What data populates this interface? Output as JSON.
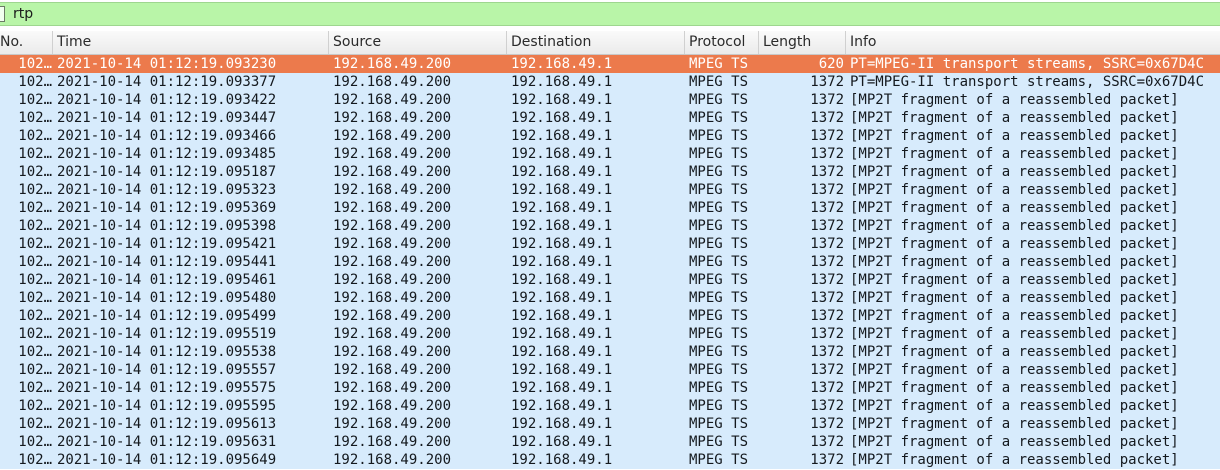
{
  "filter": {
    "value": "rtp"
  },
  "columns": {
    "no": "No.",
    "time": "Time",
    "source": "Source",
    "destination": "Destination",
    "protocol": "Protocol",
    "length": "Length",
    "info": "Info"
  },
  "colors": {
    "filter_bg": "#b9f5a8",
    "row_bg": "#d7ebfc",
    "selected_bg": "#ec7a4c"
  },
  "rows": [
    {
      "no": "102…",
      "time": "2021-10-14 01:12:19.093230",
      "source": "192.168.49.200",
      "destination": "192.168.49.1",
      "protocol": "MPEG TS",
      "length": "620",
      "info": "PT=MPEG-II transport streams, SSRC=0x67D4C",
      "selected": true
    },
    {
      "no": "102…",
      "time": "2021-10-14 01:12:19.093377",
      "source": "192.168.49.200",
      "destination": "192.168.49.1",
      "protocol": "MPEG TS",
      "length": "1372",
      "info": "PT=MPEG-II transport streams, SSRC=0x67D4C"
    },
    {
      "no": "102…",
      "time": "2021-10-14 01:12:19.093422",
      "source": "192.168.49.200",
      "destination": "192.168.49.1",
      "protocol": "MPEG TS",
      "length": "1372",
      "info": "[MP2T fragment of a reassembled packet]"
    },
    {
      "no": "102…",
      "time": "2021-10-14 01:12:19.093447",
      "source": "192.168.49.200",
      "destination": "192.168.49.1",
      "protocol": "MPEG TS",
      "length": "1372",
      "info": "[MP2T fragment of a reassembled packet]"
    },
    {
      "no": "102…",
      "time": "2021-10-14 01:12:19.093466",
      "source": "192.168.49.200",
      "destination": "192.168.49.1",
      "protocol": "MPEG TS",
      "length": "1372",
      "info": "[MP2T fragment of a reassembled packet]"
    },
    {
      "no": "102…",
      "time": "2021-10-14 01:12:19.093485",
      "source": "192.168.49.200",
      "destination": "192.168.49.1",
      "protocol": "MPEG TS",
      "length": "1372",
      "info": "[MP2T fragment of a reassembled packet]"
    },
    {
      "no": "102…",
      "time": "2021-10-14 01:12:19.095187",
      "source": "192.168.49.200",
      "destination": "192.168.49.1",
      "protocol": "MPEG TS",
      "length": "1372",
      "info": "[MP2T fragment of a reassembled packet]"
    },
    {
      "no": "102…",
      "time": "2021-10-14 01:12:19.095323",
      "source": "192.168.49.200",
      "destination": "192.168.49.1",
      "protocol": "MPEG TS",
      "length": "1372",
      "info": "[MP2T fragment of a reassembled packet]"
    },
    {
      "no": "102…",
      "time": "2021-10-14 01:12:19.095369",
      "source": "192.168.49.200",
      "destination": "192.168.49.1",
      "protocol": "MPEG TS",
      "length": "1372",
      "info": "[MP2T fragment of a reassembled packet]"
    },
    {
      "no": "102…",
      "time": "2021-10-14 01:12:19.095398",
      "source": "192.168.49.200",
      "destination": "192.168.49.1",
      "protocol": "MPEG TS",
      "length": "1372",
      "info": "[MP2T fragment of a reassembled packet]"
    },
    {
      "no": "102…",
      "time": "2021-10-14 01:12:19.095421",
      "source": "192.168.49.200",
      "destination": "192.168.49.1",
      "protocol": "MPEG TS",
      "length": "1372",
      "info": "[MP2T fragment of a reassembled packet]"
    },
    {
      "no": "102…",
      "time": "2021-10-14 01:12:19.095441",
      "source": "192.168.49.200",
      "destination": "192.168.49.1",
      "protocol": "MPEG TS",
      "length": "1372",
      "info": "[MP2T fragment of a reassembled packet]"
    },
    {
      "no": "102…",
      "time": "2021-10-14 01:12:19.095461",
      "source": "192.168.49.200",
      "destination": "192.168.49.1",
      "protocol": "MPEG TS",
      "length": "1372",
      "info": "[MP2T fragment of a reassembled packet]"
    },
    {
      "no": "102…",
      "time": "2021-10-14 01:12:19.095480",
      "source": "192.168.49.200",
      "destination": "192.168.49.1",
      "protocol": "MPEG TS",
      "length": "1372",
      "info": "[MP2T fragment of a reassembled packet]"
    },
    {
      "no": "102…",
      "time": "2021-10-14 01:12:19.095499",
      "source": "192.168.49.200",
      "destination": "192.168.49.1",
      "protocol": "MPEG TS",
      "length": "1372",
      "info": "[MP2T fragment of a reassembled packet]"
    },
    {
      "no": "102…",
      "time": "2021-10-14 01:12:19.095519",
      "source": "192.168.49.200",
      "destination": "192.168.49.1",
      "protocol": "MPEG TS",
      "length": "1372",
      "info": "[MP2T fragment of a reassembled packet]"
    },
    {
      "no": "102…",
      "time": "2021-10-14 01:12:19.095538",
      "source": "192.168.49.200",
      "destination": "192.168.49.1",
      "protocol": "MPEG TS",
      "length": "1372",
      "info": "[MP2T fragment of a reassembled packet]"
    },
    {
      "no": "102…",
      "time": "2021-10-14 01:12:19.095557",
      "source": "192.168.49.200",
      "destination": "192.168.49.1",
      "protocol": "MPEG TS",
      "length": "1372",
      "info": "[MP2T fragment of a reassembled packet]"
    },
    {
      "no": "102…",
      "time": "2021-10-14 01:12:19.095575",
      "source": "192.168.49.200",
      "destination": "192.168.49.1",
      "protocol": "MPEG TS",
      "length": "1372",
      "info": "[MP2T fragment of a reassembled packet]"
    },
    {
      "no": "102…",
      "time": "2021-10-14 01:12:19.095595",
      "source": "192.168.49.200",
      "destination": "192.168.49.1",
      "protocol": "MPEG TS",
      "length": "1372",
      "info": "[MP2T fragment of a reassembled packet]"
    },
    {
      "no": "102…",
      "time": "2021-10-14 01:12:19.095613",
      "source": "192.168.49.200",
      "destination": "192.168.49.1",
      "protocol": "MPEG TS",
      "length": "1372",
      "info": "[MP2T fragment of a reassembled packet]"
    },
    {
      "no": "102…",
      "time": "2021-10-14 01:12:19.095631",
      "source": "192.168.49.200",
      "destination": "192.168.49.1",
      "protocol": "MPEG TS",
      "length": "1372",
      "info": "[MP2T fragment of a reassembled packet]"
    },
    {
      "no": "102…",
      "time": "2021-10-14 01:12:19.095649",
      "source": "192.168.49.200",
      "destination": "192.168.49.1",
      "protocol": "MPEG TS",
      "length": "1372",
      "info": "[MP2T fragment of a reassembled packet]"
    }
  ]
}
